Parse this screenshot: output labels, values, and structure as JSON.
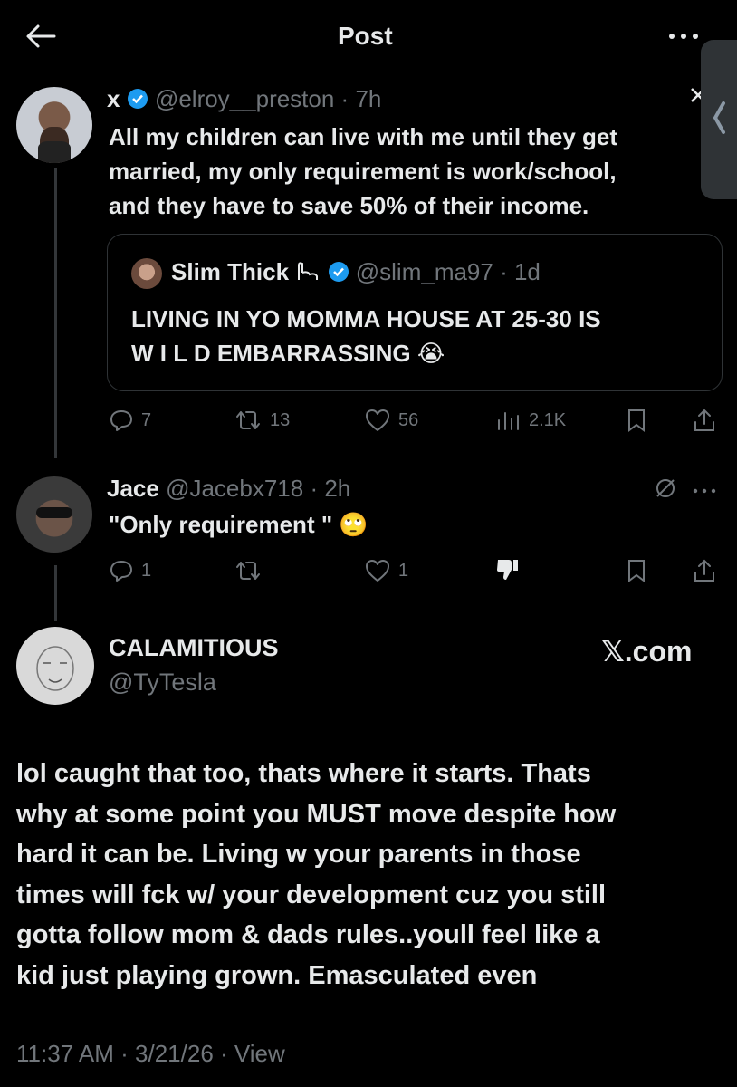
{
  "header": {
    "title": "Post"
  },
  "main_tweet": {
    "name": "x",
    "handle": "@elroy__preston",
    "time": "7h",
    "text_line1": "All my children can live with me until they get",
    "text_line2": "married, my only requirement is work/school,",
    "text_line3": "and they have to save 50% of their income.",
    "quote": {
      "name": "Slim Thick",
      "handle": "@slim_ma97",
      "time": "1d",
      "text_line1": "LIVING IN YO MOMMA HOUSE AT 25-30 IS",
      "text_line2": "W I L D EMBARRASSING 😭"
    },
    "replies": "7",
    "reposts": "13",
    "likes": "56",
    "views": "2.1K"
  },
  "reply": {
    "name": "Jace",
    "handle": "@Jacebx718",
    "time": "2h",
    "text": "\"Only requirement \" 🙄",
    "replies": "1",
    "likes": "1"
  },
  "quote_post": {
    "name": "CALAMITIOUS",
    "handle": "@TyTesla",
    "brand": "𝕏.com",
    "lines": [
      "lol caught that too, thats where it starts. Thats",
      "why at some point you MUST move despite how",
      "hard it can be. Living w your parents in those",
      "times will fck w/ your development cuz you still",
      "gotta follow mom & dads rules..youll feel like a",
      "kid just playing grown. Emasculated even"
    ],
    "footer": "11:37 AM · 3/21/26 · View"
  },
  "colors": {
    "background": "#000000",
    "text": "#e7e9ea",
    "muted": "#71767b",
    "verified": "#1d9bf0"
  }
}
